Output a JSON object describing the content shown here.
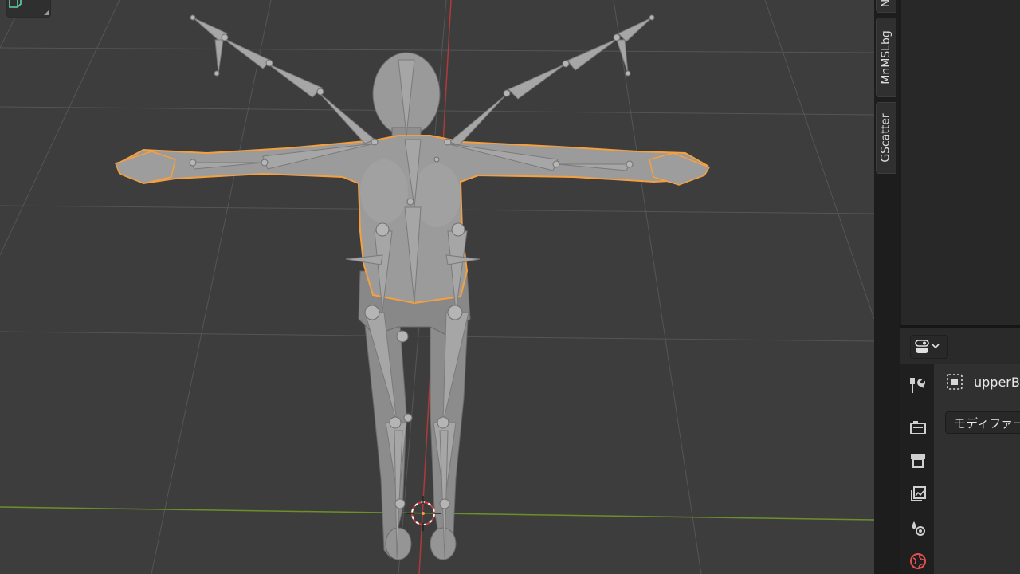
{
  "viewport": {
    "name": "3D Viewport",
    "selected_object_outline": "#f5a040",
    "x_axis_color": "#6b8f2a",
    "y_axis_color": "#b03a3a",
    "grid_color": "#555555"
  },
  "gizmo": {
    "icon": "cube-icon"
  },
  "npanel_tabs": [
    {
      "label": "N"
    },
    {
      "label": "MnMSLbg"
    },
    {
      "label": "GScatter"
    }
  ],
  "properties": {
    "editor_type_icon": "properties-editor-icon",
    "tabs": [
      {
        "icon": "tool-icon",
        "label": "Tool"
      },
      {
        "icon": "render-icon",
        "label": "Render"
      },
      {
        "icon": "output-icon",
        "label": "Output"
      },
      {
        "icon": "view-layer-icon",
        "label": "View Layer"
      },
      {
        "icon": "scene-icon",
        "label": "Scene"
      },
      {
        "icon": "world-icon",
        "label": "World"
      }
    ],
    "object_name": "upperB",
    "modifier_button": "モディファー"
  }
}
